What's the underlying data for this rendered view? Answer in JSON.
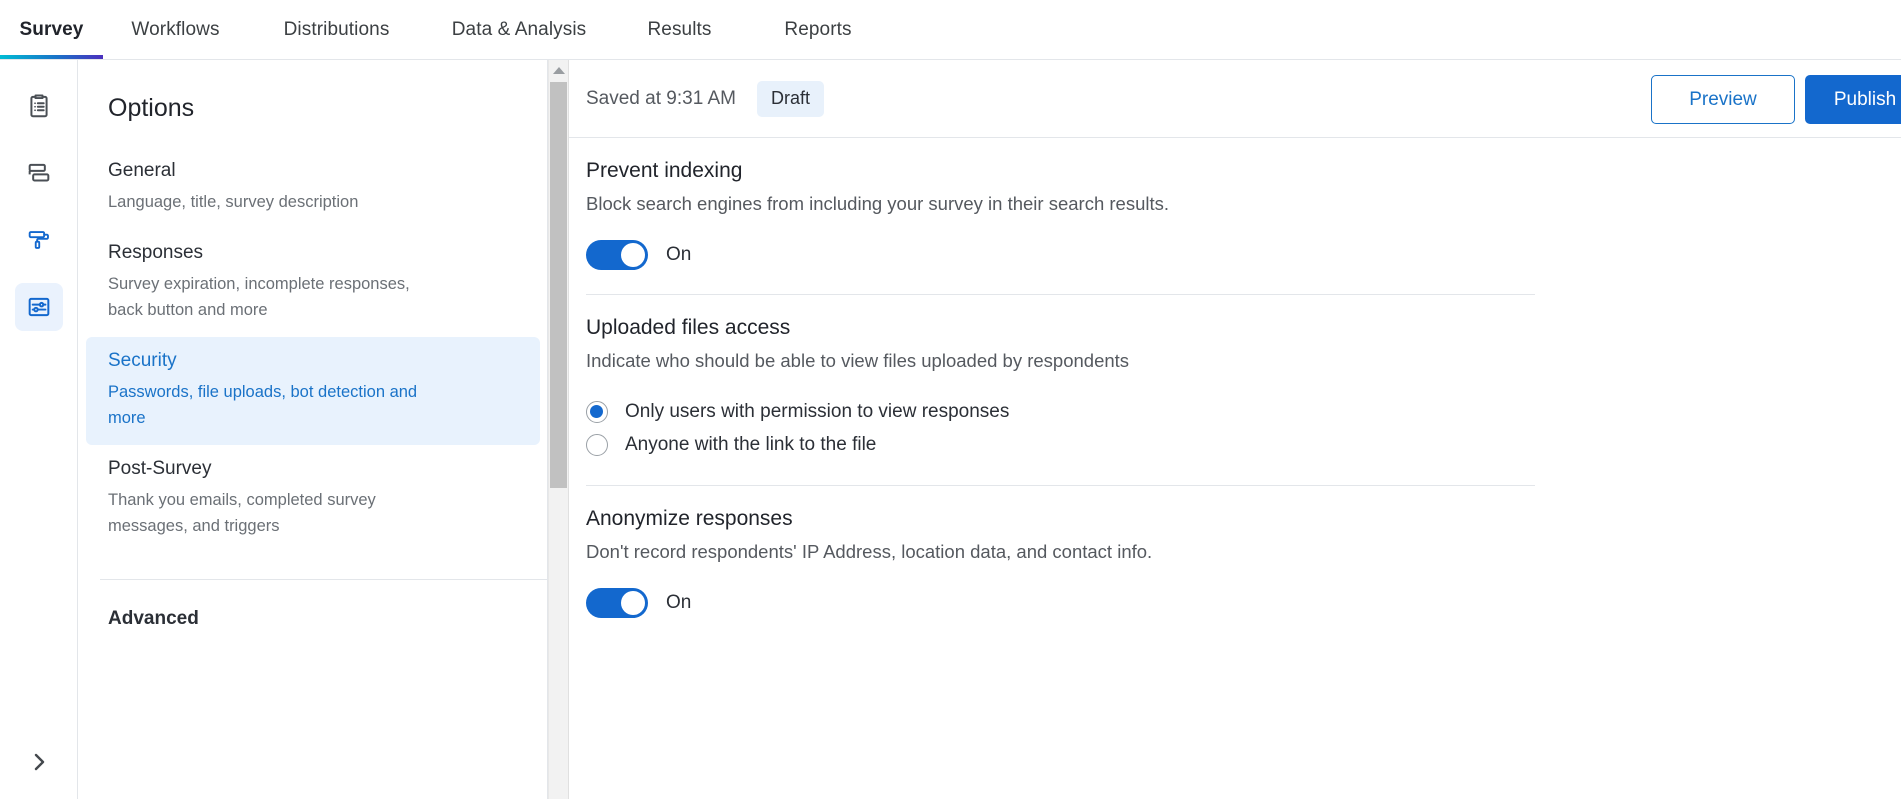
{
  "topnav": {
    "tabs": [
      {
        "label": "Survey",
        "active": true
      },
      {
        "label": "Workflows",
        "active": false
      },
      {
        "label": "Distributions",
        "active": false
      },
      {
        "label": "Data & Analysis",
        "active": false
      },
      {
        "label": "Results",
        "active": false
      },
      {
        "label": "Reports",
        "active": false
      }
    ],
    "active_underline_colors": [
      "#00bcd4",
      "#1a73c8",
      "#4b2fbe"
    ]
  },
  "rail": {
    "items": [
      {
        "icon": "clipboard-list-icon",
        "selected": false
      },
      {
        "icon": "survey-flow-blocks-icon",
        "selected": false
      },
      {
        "icon": "paint-roller-icon",
        "selected": false
      },
      {
        "icon": "options-sliders-icon",
        "selected": true
      }
    ],
    "expand": {
      "icon": "chevron-right-icon"
    }
  },
  "options_panel": {
    "title": "Options",
    "items": [
      {
        "title": "General",
        "desc": "Language, title, survey description",
        "selected": false
      },
      {
        "title": "Responses",
        "desc": "Survey expiration, incomplete responses, back button and more",
        "selected": false
      },
      {
        "title": "Security",
        "desc": "Passwords, file uploads, bot detection and more",
        "selected": true
      },
      {
        "title": "Post-Survey",
        "desc": "Thank you emails, completed survey messages, and triggers",
        "selected": false
      }
    ],
    "advanced_header": "Advanced"
  },
  "main_header": {
    "saved_text": "Saved at 9:31 AM",
    "status_badge": "Draft",
    "preview_label": "Preview",
    "publish_label": "Publish",
    "accent_color": "#1368ce"
  },
  "sections": [
    {
      "title": "Prevent indexing",
      "desc": "Block search engines from including your survey in their search results.",
      "control": "toggle",
      "toggle_state": "On"
    },
    {
      "title": "Uploaded files access",
      "desc": "Indicate who should be able to view files uploaded by respondents",
      "control": "radio",
      "options": [
        {
          "label": "Only users with permission to view responses",
          "checked": true
        },
        {
          "label": "Anyone with the link to the file",
          "checked": false
        }
      ]
    },
    {
      "title": "Anonymize responses",
      "desc": "Don't record respondents' IP Address, location data, and contact info.",
      "control": "toggle",
      "toggle_state": "On"
    }
  ]
}
